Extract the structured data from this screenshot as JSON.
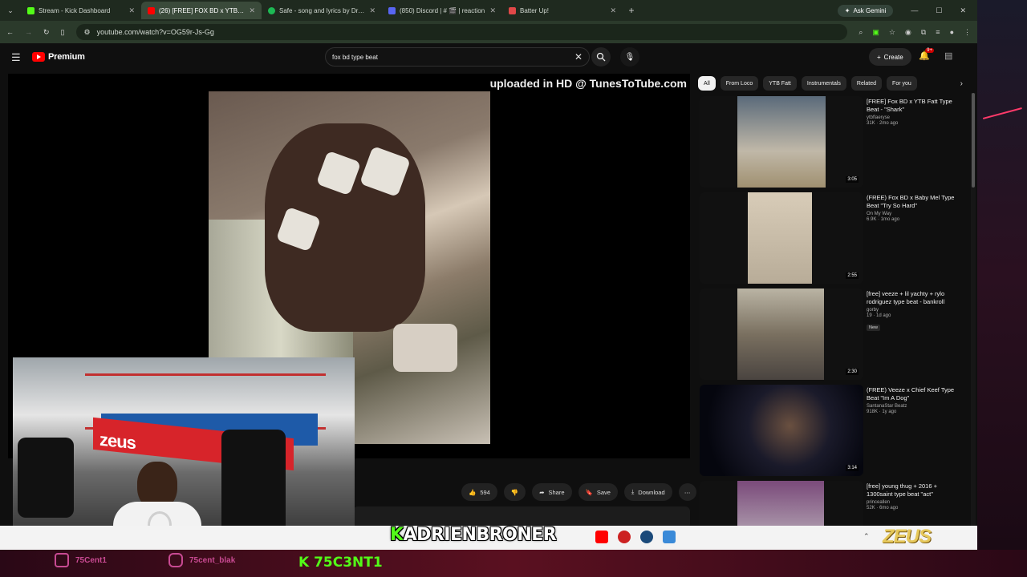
{
  "browser": {
    "tabs": [
      {
        "label": "Stream - Kick Dashboard",
        "color": "#53fc18"
      },
      {
        "label": "(26) [FREE] FOX BD x YTB FATT",
        "color": "#ff0000",
        "active": true
      },
      {
        "label": "Safe - song and lyrics by Drü C",
        "color": "#1db954"
      },
      {
        "label": "(850) Discord | # 🎬 | reaction",
        "color": "#5865f2"
      },
      {
        "label": "Batter Up!",
        "color": "#e04848"
      }
    ],
    "new_tab": "+",
    "gemini": "Ask Gemini",
    "url": "youtube.com/watch?v=OG59r-Js-Gg"
  },
  "youtube": {
    "logo_text": "Premium",
    "search_value": "fox bd type beat",
    "create_label": "Create",
    "notif_count": "9+",
    "player_caption": "uploaded in HD @ TunesToTube.com",
    "actions": {
      "likes": "594",
      "share": "Share",
      "save": "Save",
      "download": "Download"
    },
    "chips": [
      "All",
      "From Loco",
      "YTB Fatt",
      "Instrumentals",
      "Related",
      "For you"
    ],
    "recommendations": [
      {
        "title": "[FREE] Fox BD x YTB Fatt Type Beat - \"Shark\"",
        "channel": "ytbflaeryse",
        "stats": "31K · 2mo ago",
        "duration": "3:05",
        "bg": "#2a3a4a",
        "badge": ""
      },
      {
        "title": "(FREE) Fox BD x Baby Mel Type Beat \"Try So Hard\"",
        "channel": "On My Way",
        "stats": "6.9K · 1mo ago",
        "duration": "2:55",
        "bg": "#c8bca8",
        "badge": ""
      },
      {
        "title": "[free] veeze + lil yachty + rylo rodriguez type beat - bankroll",
        "channel": "gorby",
        "stats": "19 · 1d ago",
        "duration": "2:30",
        "bg": "#a8a090",
        "badge": "New"
      },
      {
        "title": "(FREE) Veeze x Chief Keef Type Beat \"Im A Dog\"",
        "channel": "SantanaStar Beatz",
        "stats": "918K · 1y ago",
        "duration": "3:14",
        "bg": "#0a0c18",
        "badge": ""
      },
      {
        "title": "[free] young thug + 2016 + 1300saint type beat \"act\"",
        "channel": "princeallen",
        "stats": "52K · 6mo ago",
        "duration": "",
        "bg": "#5a3a5a",
        "badge": ""
      }
    ]
  },
  "overlay": {
    "cam_banner": "zeus",
    "streamer_name_k": "K",
    "streamer_name_rest": "ADRIENBRONER",
    "zeus_logo": "ZEUS",
    "twitch": "75Cent1",
    "instagram": "75cent_blak",
    "kick_code": "K 75C3NT1"
  }
}
